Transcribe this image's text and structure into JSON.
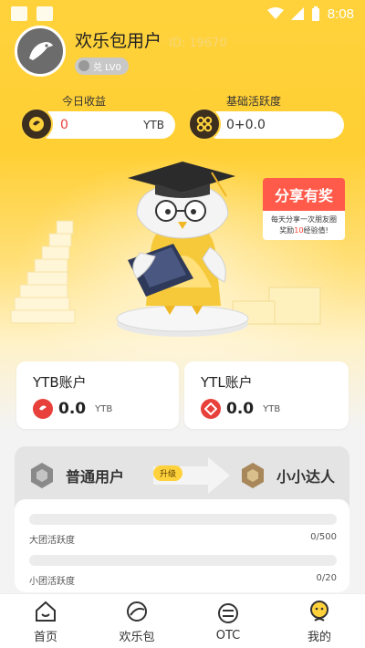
{
  "statusbar": {
    "time": "8:08"
  },
  "profile": {
    "name": "欢乐包用户",
    "id": "ID: 19670",
    "level": "兑 LV0"
  },
  "stats": {
    "earnings": {
      "label": "今日收益",
      "value": "0",
      "unit": "YTB"
    },
    "activity": {
      "label": "基础活跃度",
      "value": "0+0.0"
    }
  },
  "share": {
    "title": "分享有奖",
    "line1": "每天分享一次朋友圈",
    "line2_a": "奖励",
    "line2_num": "10",
    "line2_b": "经验值!"
  },
  "accounts": [
    {
      "title": "YTB账户",
      "value": "0.0",
      "unit": "YTB",
      "color": "#e8403a"
    },
    {
      "title": "YTL账户",
      "value": "0.0",
      "unit": "YTB",
      "color": "#e8403a"
    }
  ],
  "level_panel": {
    "current": "普通用户",
    "upgrade": "升级",
    "next": "小小达人",
    "progress": [
      {
        "label": "大团活跃度",
        "value": "0/500",
        "fraction": 0
      },
      {
        "label": "小团活跃度",
        "value": "0/20",
        "fraction": 0
      }
    ]
  },
  "nav": [
    {
      "label": "首页",
      "icon": "home-icon"
    },
    {
      "label": "欢乐包",
      "icon": "bag-icon"
    },
    {
      "label": "OTC",
      "icon": "otc-icon"
    },
    {
      "label": "我的",
      "icon": "profile-icon",
      "active": true
    }
  ],
  "colors": {
    "accent": "#ffd23c",
    "share_red": "#ff5a4a",
    "coin_red": "#e8403a"
  }
}
